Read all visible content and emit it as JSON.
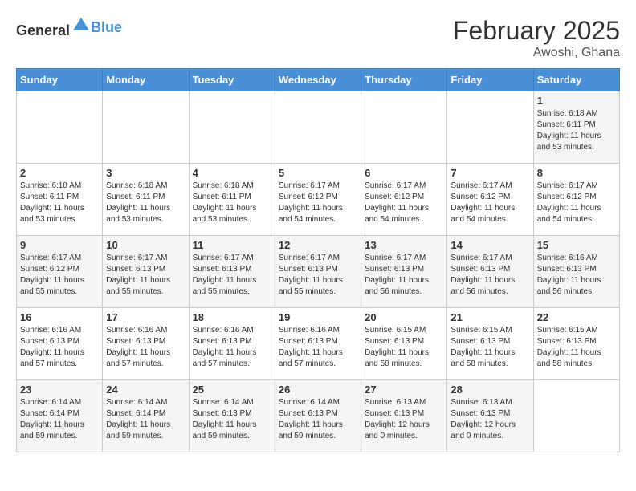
{
  "logo": {
    "text_general": "General",
    "text_blue": "Blue"
  },
  "header": {
    "month": "February 2025",
    "location": "Awoshi, Ghana"
  },
  "weekdays": [
    "Sunday",
    "Monday",
    "Tuesday",
    "Wednesday",
    "Thursday",
    "Friday",
    "Saturday"
  ],
  "weeks": [
    [
      {
        "day": "",
        "info": ""
      },
      {
        "day": "",
        "info": ""
      },
      {
        "day": "",
        "info": ""
      },
      {
        "day": "",
        "info": ""
      },
      {
        "day": "",
        "info": ""
      },
      {
        "day": "",
        "info": ""
      },
      {
        "day": "1",
        "info": "Sunrise: 6:18 AM\nSunset: 6:11 PM\nDaylight: 11 hours\nand 53 minutes."
      }
    ],
    [
      {
        "day": "2",
        "info": "Sunrise: 6:18 AM\nSunset: 6:11 PM\nDaylight: 11 hours\nand 53 minutes."
      },
      {
        "day": "3",
        "info": "Sunrise: 6:18 AM\nSunset: 6:11 PM\nDaylight: 11 hours\nand 53 minutes."
      },
      {
        "day": "4",
        "info": "Sunrise: 6:18 AM\nSunset: 6:11 PM\nDaylight: 11 hours\nand 53 minutes."
      },
      {
        "day": "5",
        "info": "Sunrise: 6:17 AM\nSunset: 6:12 PM\nDaylight: 11 hours\nand 54 minutes."
      },
      {
        "day": "6",
        "info": "Sunrise: 6:17 AM\nSunset: 6:12 PM\nDaylight: 11 hours\nand 54 minutes."
      },
      {
        "day": "7",
        "info": "Sunrise: 6:17 AM\nSunset: 6:12 PM\nDaylight: 11 hours\nand 54 minutes."
      },
      {
        "day": "8",
        "info": "Sunrise: 6:17 AM\nSunset: 6:12 PM\nDaylight: 11 hours\nand 54 minutes."
      }
    ],
    [
      {
        "day": "9",
        "info": "Sunrise: 6:17 AM\nSunset: 6:12 PM\nDaylight: 11 hours\nand 55 minutes."
      },
      {
        "day": "10",
        "info": "Sunrise: 6:17 AM\nSunset: 6:13 PM\nDaylight: 11 hours\nand 55 minutes."
      },
      {
        "day": "11",
        "info": "Sunrise: 6:17 AM\nSunset: 6:13 PM\nDaylight: 11 hours\nand 55 minutes."
      },
      {
        "day": "12",
        "info": "Sunrise: 6:17 AM\nSunset: 6:13 PM\nDaylight: 11 hours\nand 55 minutes."
      },
      {
        "day": "13",
        "info": "Sunrise: 6:17 AM\nSunset: 6:13 PM\nDaylight: 11 hours\nand 56 minutes."
      },
      {
        "day": "14",
        "info": "Sunrise: 6:17 AM\nSunset: 6:13 PM\nDaylight: 11 hours\nand 56 minutes."
      },
      {
        "day": "15",
        "info": "Sunrise: 6:16 AM\nSunset: 6:13 PM\nDaylight: 11 hours\nand 56 minutes."
      }
    ],
    [
      {
        "day": "16",
        "info": "Sunrise: 6:16 AM\nSunset: 6:13 PM\nDaylight: 11 hours\nand 57 minutes."
      },
      {
        "day": "17",
        "info": "Sunrise: 6:16 AM\nSunset: 6:13 PM\nDaylight: 11 hours\nand 57 minutes."
      },
      {
        "day": "18",
        "info": "Sunrise: 6:16 AM\nSunset: 6:13 PM\nDaylight: 11 hours\nand 57 minutes."
      },
      {
        "day": "19",
        "info": "Sunrise: 6:16 AM\nSunset: 6:13 PM\nDaylight: 11 hours\nand 57 minutes."
      },
      {
        "day": "20",
        "info": "Sunrise: 6:15 AM\nSunset: 6:13 PM\nDaylight: 11 hours\nand 58 minutes."
      },
      {
        "day": "21",
        "info": "Sunrise: 6:15 AM\nSunset: 6:13 PM\nDaylight: 11 hours\nand 58 minutes."
      },
      {
        "day": "22",
        "info": "Sunrise: 6:15 AM\nSunset: 6:13 PM\nDaylight: 11 hours\nand 58 minutes."
      }
    ],
    [
      {
        "day": "23",
        "info": "Sunrise: 6:14 AM\nSunset: 6:14 PM\nDaylight: 11 hours\nand 59 minutes."
      },
      {
        "day": "24",
        "info": "Sunrise: 6:14 AM\nSunset: 6:14 PM\nDaylight: 11 hours\nand 59 minutes."
      },
      {
        "day": "25",
        "info": "Sunrise: 6:14 AM\nSunset: 6:13 PM\nDaylight: 11 hours\nand 59 minutes."
      },
      {
        "day": "26",
        "info": "Sunrise: 6:14 AM\nSunset: 6:13 PM\nDaylight: 11 hours\nand 59 minutes."
      },
      {
        "day": "27",
        "info": "Sunrise: 6:13 AM\nSunset: 6:13 PM\nDaylight: 12 hours\nand 0 minutes."
      },
      {
        "day": "28",
        "info": "Sunrise: 6:13 AM\nSunset: 6:13 PM\nDaylight: 12 hours\nand 0 minutes."
      },
      {
        "day": "",
        "info": ""
      }
    ]
  ]
}
